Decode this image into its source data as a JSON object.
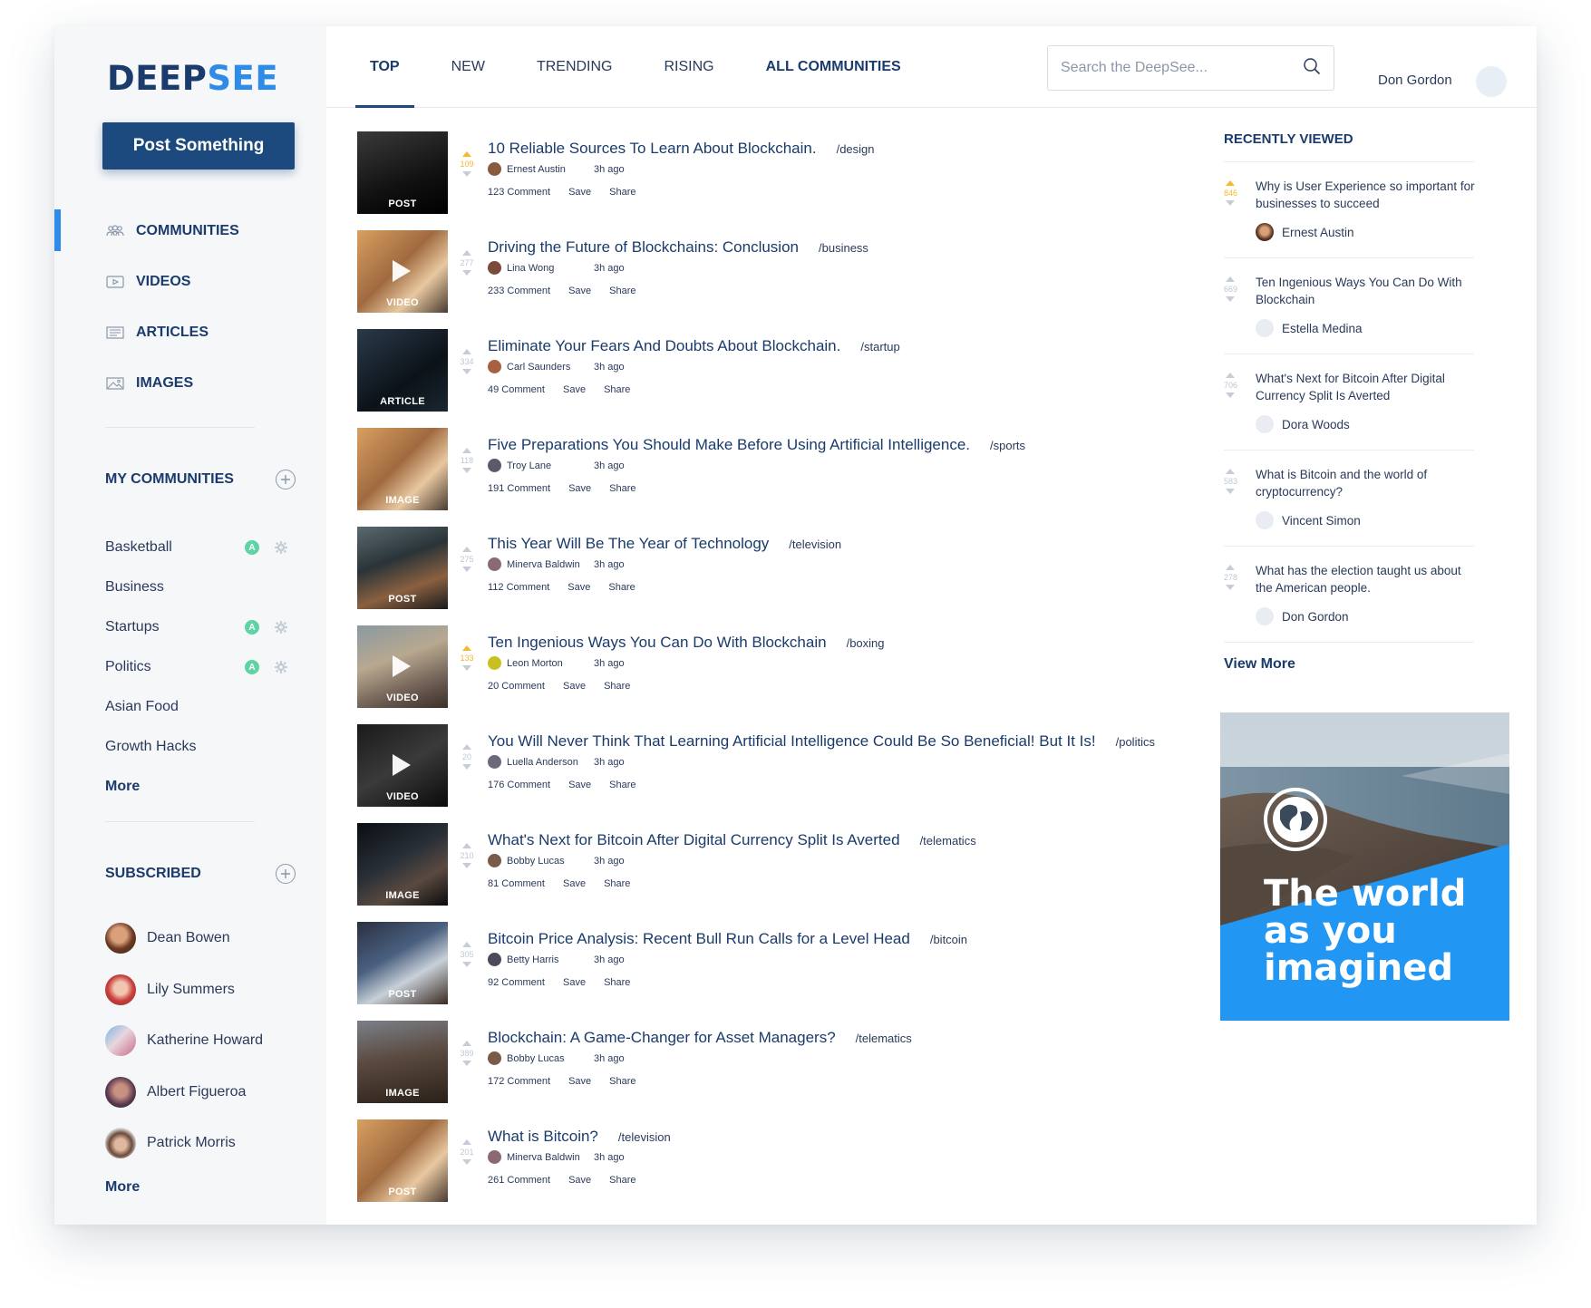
{
  "brand": {
    "part1": "DEEP",
    "part2": "SEE"
  },
  "sidebar": {
    "post_button": "Post Something",
    "nav": [
      {
        "label": "COMMUNITIES",
        "icon": "communities-icon",
        "active": true
      },
      {
        "label": "VIDEOS",
        "icon": "video-icon"
      },
      {
        "label": "ARTICLES",
        "icon": "article-icon"
      },
      {
        "label": "IMAGES",
        "icon": "image-icon"
      }
    ],
    "my_communities_title": "MY COMMUNITIES",
    "communities": [
      {
        "name": "Basketball",
        "admin": true
      },
      {
        "name": "Business",
        "admin": false
      },
      {
        "name": "Startups",
        "admin": true
      },
      {
        "name": "Politics",
        "admin": true
      },
      {
        "name": "Asian Food",
        "admin": false
      },
      {
        "name": "Growth Hacks",
        "admin": false
      }
    ],
    "admin_badge": "A",
    "communities_more": "More",
    "subscribed_title": "SUBSCRIBED",
    "subscribed": [
      {
        "name": "Dean Bowen"
      },
      {
        "name": "Lily Summers"
      },
      {
        "name": "Katherine Howard"
      },
      {
        "name": "Albert Figueroa"
      },
      {
        "name": "Patrick Morris"
      }
    ],
    "subscribed_more": "More"
  },
  "header": {
    "tabs": [
      "TOP",
      "NEW",
      "TRENDING",
      "RISING",
      "ALL COMMUNITIES"
    ],
    "active_tab": "TOP",
    "search_placeholder": "Search the DeepSee...",
    "user_name": "Don Gordon"
  },
  "posts": [
    {
      "type": "POST",
      "votes": "109",
      "hot": true,
      "title": "10 Reliable Sources To Learn About Blockchain.",
      "community": "/design",
      "author": "Ernest Austin",
      "time": "3h ago",
      "comments": "123 Comment",
      "save": "Save",
      "share": "Share",
      "play": false
    },
    {
      "type": "VIDEO",
      "votes": "277",
      "hot": false,
      "title": "Driving the Future of Blockchains: Conclusion",
      "community": "/business",
      "author": "Lina Wong",
      "time": "3h ago",
      "comments": "233 Comment",
      "save": "Save",
      "share": "Share",
      "play": true
    },
    {
      "type": "ARTICLE",
      "votes": "334",
      "hot": false,
      "title": "Eliminate Your Fears And Doubts About Blockchain.",
      "community": "/startup",
      "author": "Carl Saunders",
      "time": "3h ago",
      "comments": "49 Comment",
      "save": "Save",
      "share": "Share",
      "play": false
    },
    {
      "type": "IMAGE",
      "votes": "118",
      "hot": false,
      "title": "Five Preparations You Should Make Before Using Artificial Intelligence.",
      "community": "/sports",
      "author": "Troy Lane",
      "time": "3h ago",
      "comments": "191 Comment",
      "save": "Save",
      "share": "Share",
      "play": false
    },
    {
      "type": "POST",
      "votes": "275",
      "hot": false,
      "title": "This Year Will Be The Year of Technology",
      "community": "/television",
      "author": "Minerva Baldwin",
      "time": "3h ago",
      "comments": "112 Comment",
      "save": "Save",
      "share": "Share",
      "play": false
    },
    {
      "type": "VIDEO",
      "votes": "133",
      "hot": true,
      "title": "Ten Ingenious Ways You Can Do With Blockchain",
      "community": "/boxing",
      "author": "Leon Morton",
      "time": "3h ago",
      "comments": "20 Comment",
      "save": "Save",
      "share": "Share",
      "play": true
    },
    {
      "type": "VIDEO",
      "votes": "20",
      "hot": false,
      "title": "You Will Never Think That Learning Artificial Intelligence Could Be So Beneficial! But It Is!",
      "community": "/politics",
      "author": "Luella Anderson",
      "time": "3h ago",
      "comments": "176 Comment",
      "save": "Save",
      "share": "Share",
      "play": true
    },
    {
      "type": "IMAGE",
      "votes": "210",
      "hot": false,
      "title": "What's Next for Bitcoin After Digital Currency Split Is Averted",
      "community": "/telematics",
      "author": "Bobby Lucas",
      "time": "3h ago",
      "comments": "81 Comment",
      "save": "Save",
      "share": "Share",
      "play": false
    },
    {
      "type": "POST",
      "votes": "305",
      "hot": false,
      "title": "Bitcoin Price Analysis: Recent Bull Run Calls for a Level Head",
      "community": "/bitcoin",
      "author": "Betty Harris",
      "time": "3h ago",
      "comments": "92 Comment",
      "save": "Save",
      "share": "Share",
      "play": false
    },
    {
      "type": "IMAGE",
      "votes": "389",
      "hot": false,
      "title": "Blockchain: A Game-Changer for Asset Managers?",
      "community": "/telematics",
      "author": "Bobby Lucas",
      "time": "3h ago",
      "comments": "172 Comment",
      "save": "Save",
      "share": "Share",
      "play": false
    },
    {
      "type": "POST",
      "votes": "201",
      "hot": false,
      "title": "What is Bitcoin?",
      "community": "/television",
      "author": "Minerva Baldwin",
      "time": "3h ago",
      "comments": "261 Comment",
      "save": "Save",
      "share": "Share",
      "play": false
    }
  ],
  "recently_viewed": {
    "title": "RECENTLY VIEWED",
    "items": [
      {
        "votes": "846",
        "hot": true,
        "question": "Why is User Experience so important for businesses to succeed",
        "author": "Ernest Austin",
        "has_photo": true
      },
      {
        "votes": "669",
        "hot": false,
        "question": "Ten Ingenious Ways You Can Do With Blockchain",
        "author": "Estella Medina",
        "has_photo": false
      },
      {
        "votes": "706",
        "hot": false,
        "question": "What's Next for Bitcoin After Digital Currency Split Is Averted",
        "author": "Dora Woods",
        "has_photo": false
      },
      {
        "votes": "583",
        "hot": false,
        "question": "What is Bitcoin and the world of cryptocurrency?",
        "author": "Vincent Simon",
        "has_photo": false
      },
      {
        "votes": "278",
        "hot": false,
        "question": "What has the election taught us about the American people.",
        "author": "Don Gordon",
        "has_photo": false
      }
    ],
    "view_more": "View More"
  },
  "ad": {
    "line1": "The world",
    "line2": "as you",
    "line3": "imagined"
  },
  "colors": {
    "navy": "#1a3b6b",
    "button": "#1d4a7e",
    "accent": "#2e8ce8",
    "hot": "#f5b82e",
    "badge": "#5fd3a3",
    "ad_blue": "#2196f3"
  }
}
